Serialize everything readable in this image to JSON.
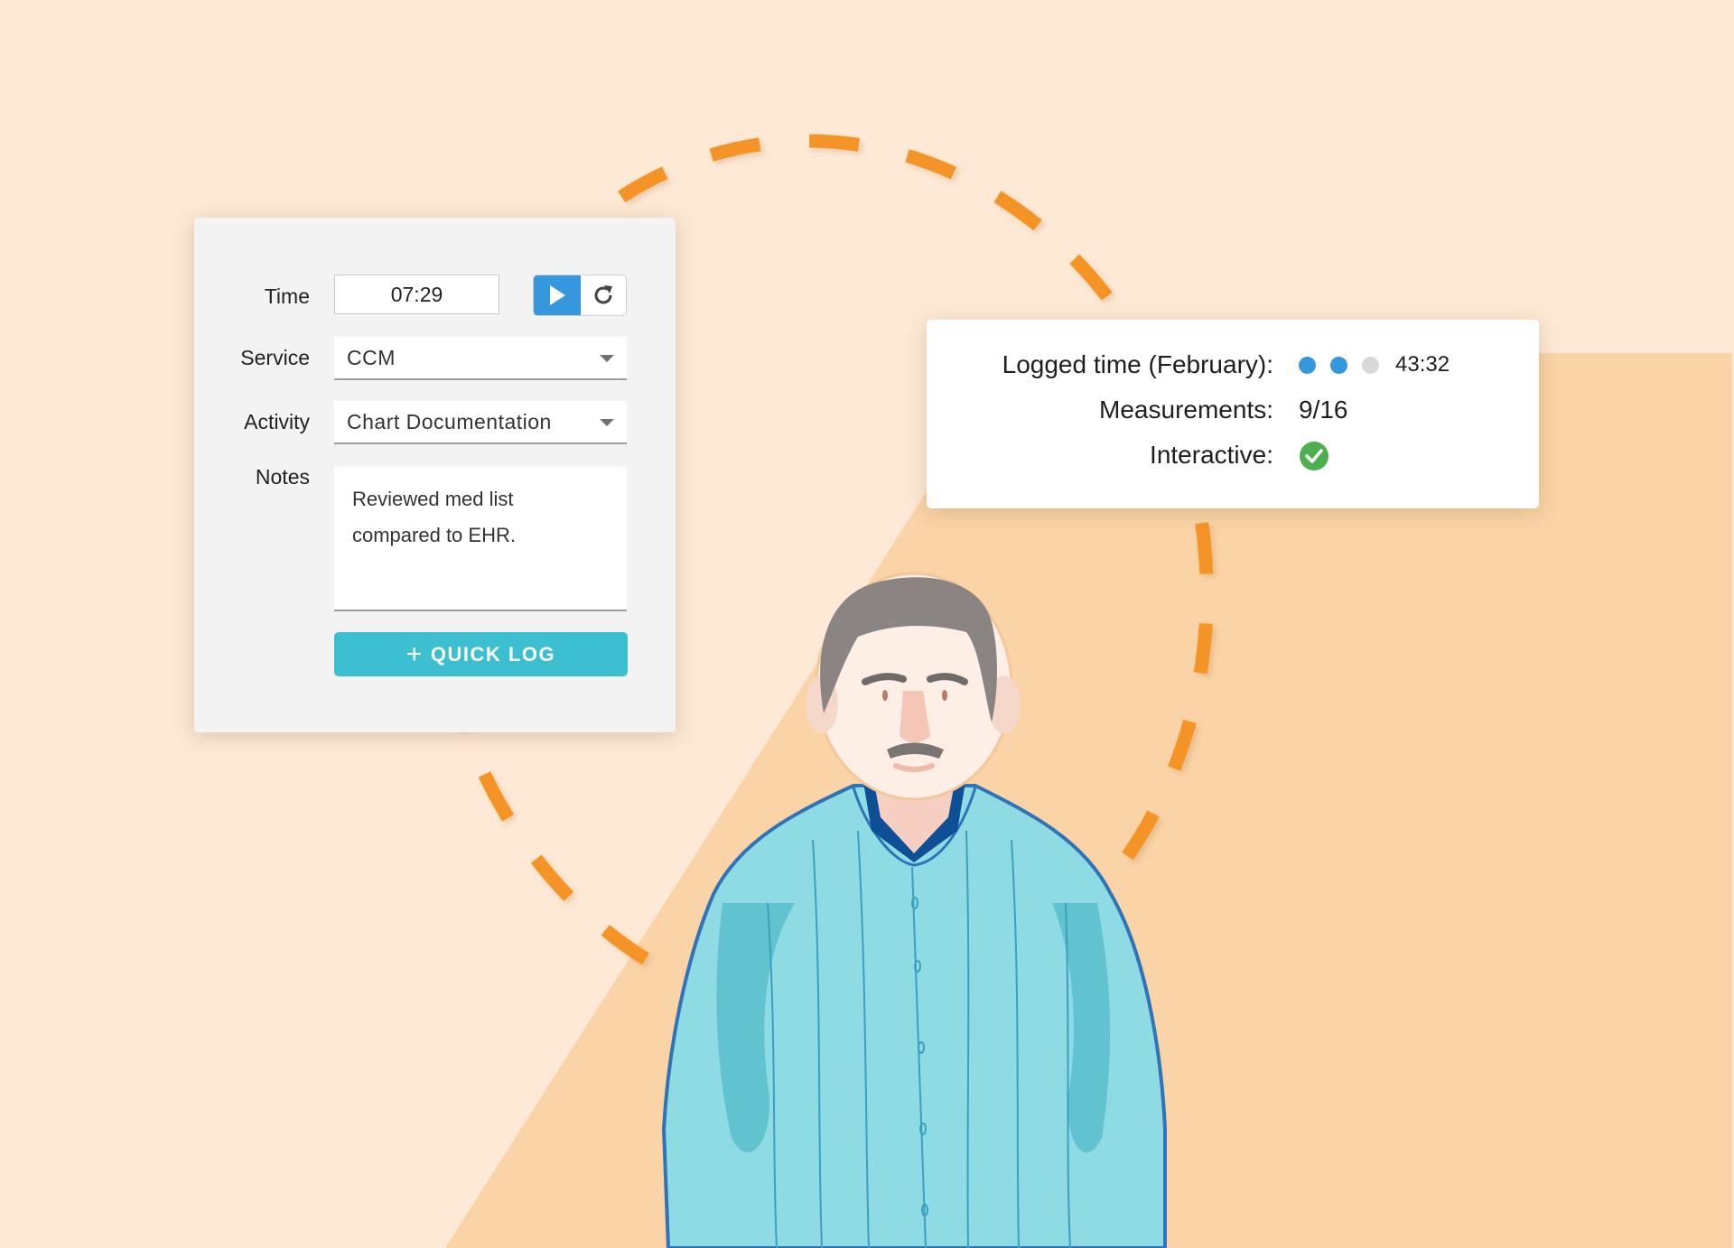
{
  "colors": {
    "background_light": "#fde9d5",
    "background_dark": "#fad3a6",
    "dash_orange": "#f59425",
    "accent_blue": "#3597dd",
    "quick_log_teal": "#3cbfd1",
    "check_green": "#4caf50",
    "dot_inactive": "#d8d8d8"
  },
  "log_card": {
    "time": {
      "label": "Time",
      "value": "07:29"
    },
    "play_button": {
      "icon": "play-icon"
    },
    "reset_button": {
      "icon": "refresh-icon"
    },
    "service": {
      "label": "Service",
      "value": "CCM"
    },
    "activity": {
      "label": "Activity",
      "value": "Chart Documentation"
    },
    "notes": {
      "label": "Notes",
      "line1": "Reviewed med list",
      "line2": "compared to EHR."
    },
    "quick_log_button": {
      "icon": "plus-icon",
      "plus": "+",
      "label": "QUICK LOG"
    }
  },
  "summary_card": {
    "logged_time": {
      "label": "Logged time (February):",
      "progress_dots": [
        true,
        true,
        false
      ],
      "value": "43:32"
    },
    "measurements": {
      "label": "Measurements:",
      "value": "9/16"
    },
    "interactive": {
      "label": "Interactive:",
      "status": "checked",
      "icon": "check-circle-icon"
    }
  }
}
